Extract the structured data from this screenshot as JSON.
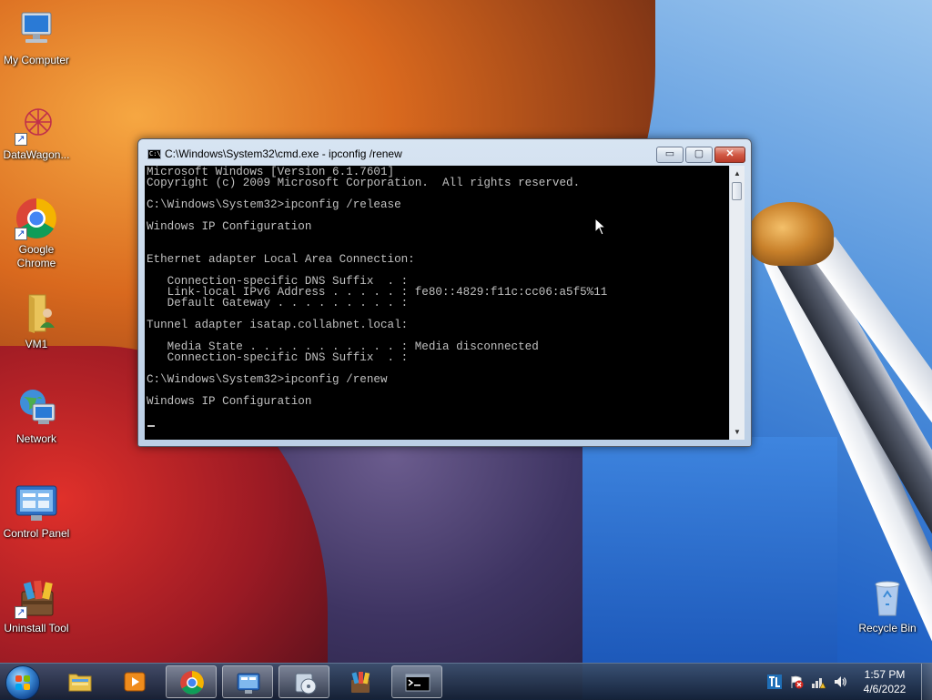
{
  "desktop": {
    "icons": [
      {
        "label": "My Computer",
        "icon": "my-computer-icon"
      },
      {
        "label": "DataWagon...",
        "icon": "datawagon-icon"
      },
      {
        "label": "Google\nChrome",
        "icon": "chrome-icon"
      },
      {
        "label": "VM1",
        "icon": "folder-user-icon"
      },
      {
        "label": "Network",
        "icon": "network-icon"
      },
      {
        "label": "Control Panel",
        "icon": "control-panel-icon"
      },
      {
        "label": "Uninstall Tool",
        "icon": "uninstall-tool-icon"
      },
      {
        "label": "Recycle Bin",
        "icon": "recycle-bin-icon"
      }
    ]
  },
  "cmd_window": {
    "title": "C:\\Windows\\System32\\cmd.exe - ipconfig  /renew",
    "buttons": {
      "minimize": "▭",
      "maximize": "▢",
      "close": "✕"
    },
    "console_lines": [
      "Microsoft Windows [Version 6.1.7601]",
      "Copyright (c) 2009 Microsoft Corporation.  All rights reserved.",
      "",
      "C:\\Windows\\System32>ipconfig /release",
      "",
      "Windows IP Configuration",
      "",
      "",
      "Ethernet adapter Local Area Connection:",
      "",
      "   Connection-specific DNS Suffix  . :",
      "   Link-local IPv6 Address . . . . . : fe80::4829:f11c:cc06:a5f5%11",
      "   Default Gateway . . . . . . . . . :",
      "",
      "Tunnel adapter isatap.collabnet.local:",
      "",
      "   Media State . . . . . . . . . . . : Media disconnected",
      "   Connection-specific DNS Suffix  . :",
      "",
      "C:\\Windows\\System32>ipconfig /renew",
      "",
      "Windows IP Configuration",
      "",
      ""
    ]
  },
  "taskbar": {
    "pinned": [
      "windows-explorer-icon",
      "media-player-icon",
      "chrome-icon",
      "control-panel-icon",
      "disk-tool-icon",
      "uninstall-tool-icon",
      "command-prompt-icon"
    ],
    "clock": {
      "time": "1:57 PM",
      "date": "4/6/2022"
    }
  },
  "colors": {
    "console_bg": "#000000",
    "console_fg": "#c0c0c0",
    "close_button": "#c8422f"
  }
}
